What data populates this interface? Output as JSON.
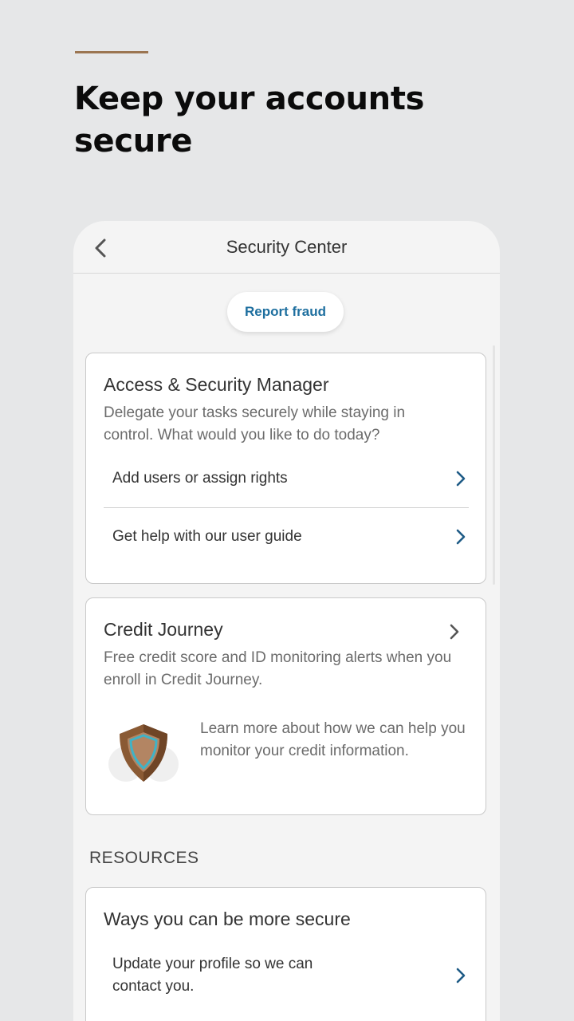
{
  "hero": {
    "title": "Keep your accounts secure"
  },
  "header": {
    "title": "Security Center"
  },
  "report_fraud": {
    "label": "Report fraud"
  },
  "access_card": {
    "title": "Access & Security Manager",
    "description": "Delegate your tasks securely while staying in control. What would you like to do today?",
    "rows": [
      {
        "label": "Add users or assign rights"
      },
      {
        "label": "Get help with our user guide"
      }
    ]
  },
  "credit_card": {
    "title": "Credit Journey",
    "description": "Free credit score and ID monitoring alerts when you enroll in Credit Journey.",
    "promo": "Learn more about how we can help you monitor your credit information."
  },
  "resources": {
    "section_label": "RESOURCES",
    "card_title": "Ways you can be more secure",
    "rows": [
      {
        "label": "Update your profile so we can contact you."
      }
    ]
  },
  "colors": {
    "accent": "#9b7551",
    "link": "#1e6f9f",
    "chevron": "#1e5b86",
    "background": "#e6e7e8",
    "panel": "#f4f4f4"
  },
  "icons": [
    "back-arrow-icon",
    "chevron-right-icon",
    "shield-icon"
  ]
}
